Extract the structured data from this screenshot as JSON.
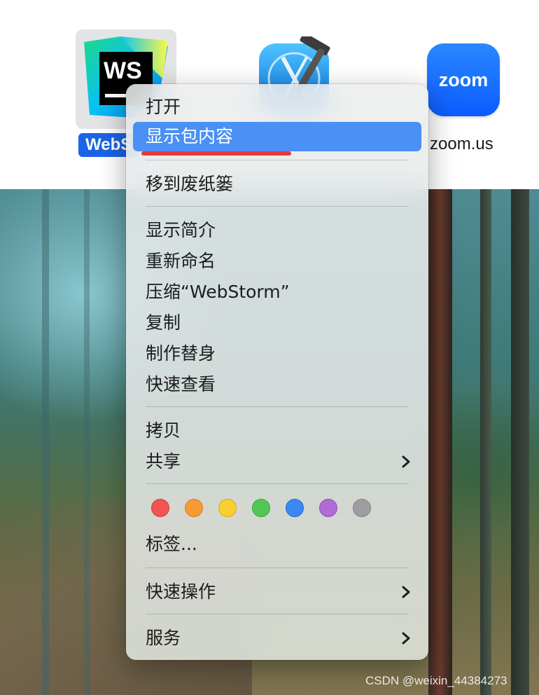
{
  "desktop": {
    "apps": [
      {
        "name": "WebStorm",
        "label": "WebS",
        "icon": "webstorm-icon",
        "selected": true
      },
      {
        "name": "Xcode",
        "icon": "xcode-icon"
      },
      {
        "name": "zoom.us",
        "label": "zoom.us",
        "icon": "zoom-icon",
        "icon_text": "zoom"
      }
    ]
  },
  "context_menu": {
    "items": [
      {
        "label": "打开"
      },
      {
        "label": "显示包内容",
        "highlighted": true
      },
      {
        "label": "移到废纸篓"
      },
      {
        "label": "显示简介"
      },
      {
        "label": "重新命名"
      },
      {
        "label": "压缩“WebStorm”"
      },
      {
        "label": "复制"
      },
      {
        "label": "制作替身"
      },
      {
        "label": "快速查看"
      },
      {
        "label": "拷贝"
      },
      {
        "label": "共享",
        "submenu": true
      },
      {
        "label": "标签..."
      },
      {
        "label": "快速操作",
        "submenu": true
      },
      {
        "label": "服务",
        "submenu": true
      }
    ],
    "tag_colors": [
      "#f05455",
      "#f79a33",
      "#f9ce30",
      "#52c757",
      "#3a89f3",
      "#b06bd6",
      "#9d9da2"
    ],
    "highlight_color": "#4a90f5",
    "annotation_color": "#e8383d"
  },
  "watermark": "CSDN @weixin_44384273"
}
